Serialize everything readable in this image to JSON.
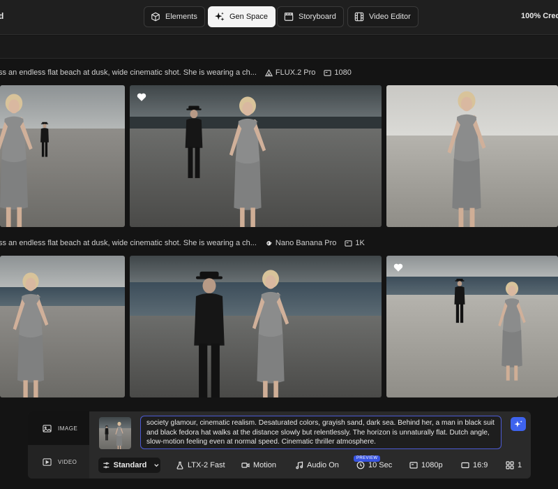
{
  "header": {
    "brand_fragment": "d",
    "nav": [
      {
        "label": "Elements",
        "icon": "cube-icon",
        "active": false
      },
      {
        "label": "Gen Space",
        "icon": "sparkle-icon",
        "active": true
      },
      {
        "label": "Storyboard",
        "icon": "clapperboard-icon",
        "active": false
      },
      {
        "label": "Video Editor",
        "icon": "film-grid-icon",
        "active": false
      }
    ],
    "credits": "100% Cred"
  },
  "generations": [
    {
      "prompt": "ss an endless flat beach at dusk, wide cinematic shot. She is wearing a ch...",
      "model": "FLUX.2 Pro",
      "model_icon": "flux-triangle-icon",
      "resolution": "1080",
      "resolution_icon": "resolution-icon",
      "liked_tile": 1
    },
    {
      "prompt": "ss an endless flat beach at dusk, wide cinematic shot. She is wearing a ch...",
      "model": "Nano Banana Pro",
      "model_icon": "google-g-icon",
      "resolution": "1K",
      "resolution_icon": "resolution-icon",
      "liked_tile": 2
    }
  ],
  "composer": {
    "modes": [
      {
        "label": "IMAGE",
        "icon": "image-icon",
        "active": true
      },
      {
        "label": "VIDEO",
        "icon": "video-icon",
        "active": false
      }
    ],
    "prompt_text": "society glamour, cinematic realism. Desaturated colors, grayish sand, dark sea. Behind her, a man in black suit and black fedora hat walks at the distance slowly but relentlessly. The horizon is unnaturally flat. Dutch angle, slow-motion feeling even at normal speed. Cinematic thriller atmosphere.",
    "options": {
      "quality": "Standard",
      "model": "LTX-2 Fast",
      "motion": "Motion",
      "audio": "Audio On",
      "audio_badge": "PREVIEW",
      "duration": "10 Sec",
      "resolution": "1080p",
      "aspect": "16:9",
      "count": "1"
    }
  },
  "colors": {
    "background": "#141414",
    "accent": "#3e63ee",
    "active_nav": "#f4f4f4"
  }
}
